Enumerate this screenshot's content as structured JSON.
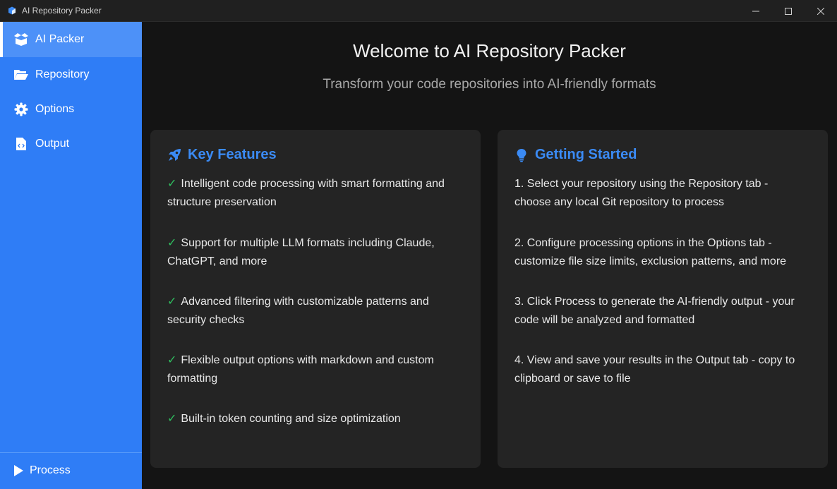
{
  "window": {
    "title": "AI Repository Packer",
    "controls": [
      "minimize",
      "maximize",
      "close"
    ]
  },
  "sidebar": {
    "items": [
      {
        "label": "AI Packer",
        "icon": "box-icon",
        "active": true
      },
      {
        "label": "Repository",
        "icon": "folder-open-icon",
        "active": false
      },
      {
        "label": "Options",
        "icon": "gear-icon",
        "active": false
      },
      {
        "label": "Output",
        "icon": "file-code-icon",
        "active": false
      }
    ],
    "process_label": "Process"
  },
  "main": {
    "title": "Welcome to AI Repository Packer",
    "subtitle": "Transform your code repositories into AI-friendly formats",
    "features": {
      "title": "Key Features",
      "icon": "rocket-icon",
      "items": [
        "Intelligent code processing with smart formatting and structure preservation",
        "Support for multiple LLM formats including Claude, ChatGPT, and more",
        "Advanced filtering with customizable patterns and security checks",
        "Flexible output options with markdown and custom formatting",
        "Built-in token counting and size optimization"
      ]
    },
    "getting_started": {
      "title": "Getting Started",
      "icon": "lightbulb-icon",
      "items": [
        "1. Select your repository using the Repository tab - choose any local Git repository to process",
        "2. Configure processing options in the Options tab - customize file size limits, exclusion patterns, and more",
        "3. Click Process to generate the AI-friendly output - your code will be analyzed and formatted",
        "4. View and save your results in the Output tab - copy to clipboard or save to file"
      ]
    }
  },
  "colors": {
    "accent": "#2f7df6",
    "heading": "#3b8bf5",
    "check": "#2fbf5f",
    "background": "#141414",
    "card": "#242424"
  }
}
